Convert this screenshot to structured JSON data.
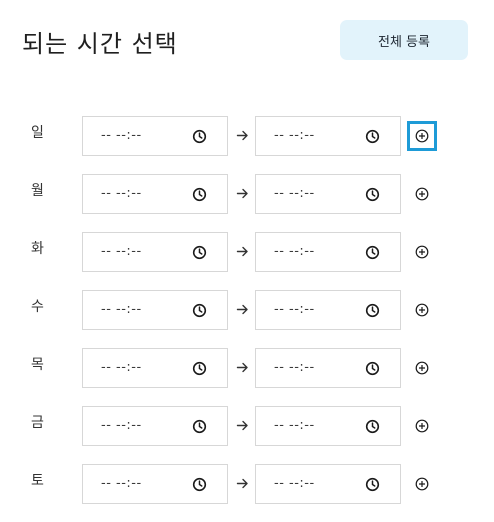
{
  "header": {
    "title": "되는 시간 선택",
    "register_all_label": "전체 등록"
  },
  "days": [
    {
      "label": "일",
      "start_time": "-- --:--",
      "end_time": "-- --:--",
      "add_focused": true
    },
    {
      "label": "월",
      "start_time": "-- --:--",
      "end_time": "-- --:--",
      "add_focused": false
    },
    {
      "label": "화",
      "start_time": "-- --:--",
      "end_time": "-- --:--",
      "add_focused": false
    },
    {
      "label": "수",
      "start_time": "-- --:--",
      "end_time": "-- --:--",
      "add_focused": false
    },
    {
      "label": "목",
      "start_time": "-- --:--",
      "end_time": "-- --:--",
      "add_focused": false
    },
    {
      "label": "금",
      "start_time": "-- --:--",
      "end_time": "-- --:--",
      "add_focused": false
    },
    {
      "label": "토",
      "start_time": "-- --:--",
      "end_time": "-- --:--",
      "add_focused": false
    }
  ],
  "icons": {
    "time": "clock-icon",
    "separator": "arrow-right-icon",
    "add": "plus-circle-icon"
  },
  "colors": {
    "register_button_bg": "#e2f3fb",
    "focus_ring": "#1e9bd7",
    "field_border": "#d7d7d7"
  }
}
